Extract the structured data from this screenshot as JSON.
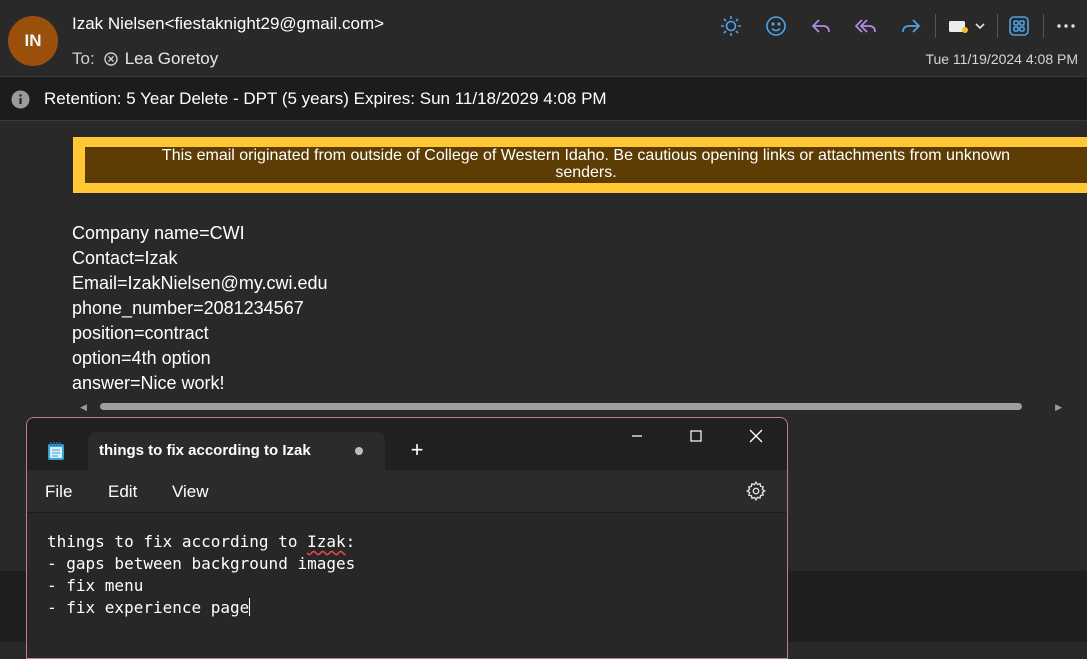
{
  "message": {
    "avatar_initials": "IN",
    "sender": "Izak Nielsen<fiestaknight29@gmail.com>",
    "to_label": "To:",
    "recipient": "Lea Goretoy",
    "date": "Tue 11/19/2024 4:08 PM",
    "retention": "Retention: 5 Year Delete - DPT (5 years) Expires: Sun 11/18/2029 4:08 PM",
    "banner_line1": "This email originated from outside of College of Western Idaho. Be cautious opening links or attachments from unknown",
    "banner_line2": "senders.",
    "body_lines": [
      "Company name=CWI",
      "Contact=Izak",
      "Email=IzakNielsen@my.cwi.edu",
      "phone_number=2081234567",
      "position=contract",
      "option=4th option",
      "answer=Nice work!"
    ]
  },
  "toolbar": {
    "icons": [
      "sun-icon",
      "emoji-icon",
      "reply-icon",
      "reply-all-icon",
      "forward-icon",
      "tag-icon",
      "apps-icon",
      "more-icon"
    ],
    "accent": "#4da3e8",
    "purple": "#b48ce6"
  },
  "notepad": {
    "tab_title": "things to fix according to Izak",
    "menu": [
      "File",
      "Edit",
      "View"
    ],
    "lines": [
      {
        "text": "things to fix according to ",
        "spell": "Izak",
        "after": ":"
      },
      {
        "text": "- gaps between background images"
      },
      {
        "text": "- fix menu"
      },
      {
        "text": "- fix experience page"
      }
    ]
  },
  "colors": {
    "avatar": "#9a4f0a",
    "banner_border": "#ffc832",
    "banner_fill": "#5e3d04",
    "notepad_border": "#c47e87"
  }
}
